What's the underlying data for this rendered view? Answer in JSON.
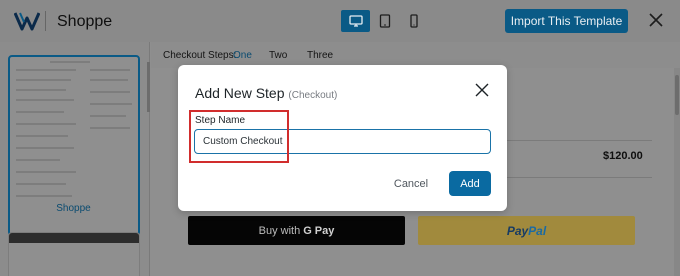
{
  "header": {
    "app_title": "Shoppe",
    "import_button_label": "Import This Template",
    "device_modes": [
      "desktop-icon",
      "tablet-icon",
      "mobile-icon"
    ],
    "active_device": "desktop"
  },
  "templates": {
    "items": [
      {
        "label": "Shoppe",
        "selected": true
      },
      {
        "label": "",
        "selected": false
      }
    ]
  },
  "steps": {
    "label": "Checkout Steps:",
    "items": [
      "One",
      "Two",
      "Three"
    ],
    "active_index": 0
  },
  "preview": {
    "price": "$120.00",
    "gpay_label": "Buy with",
    "gpay_brand": "G Pay",
    "paypal_pay": "Pay",
    "paypal_pal": "Pal"
  },
  "modal": {
    "title": "Add New Step",
    "subtitle": "(Checkout)",
    "field_label": "Step Name",
    "field_value": "Custom Checkout",
    "cancel_label": "Cancel",
    "add_label": "Add"
  },
  "colors": {
    "accent": "#0a5a86",
    "highlight": "#d12d2d",
    "add_button": "#0a6aa1"
  }
}
